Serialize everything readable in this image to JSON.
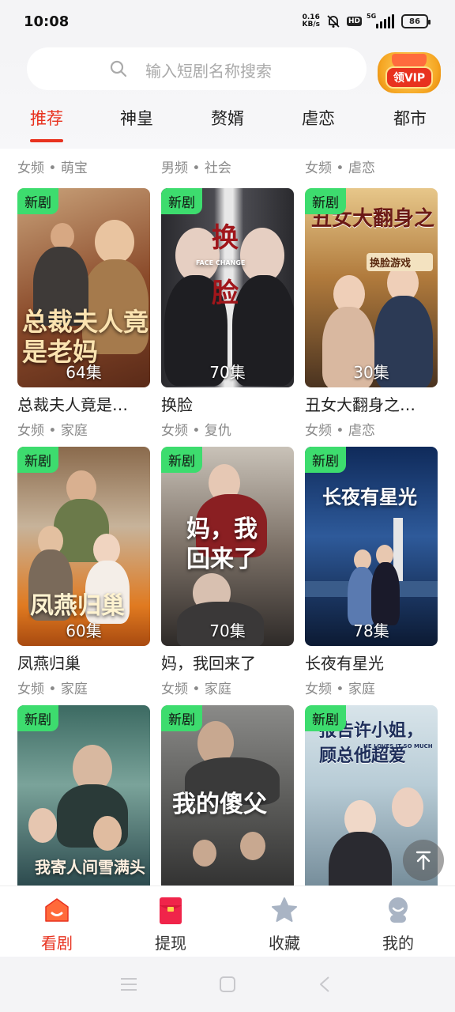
{
  "status": {
    "time": "10:08",
    "speed_top": "0.16",
    "speed_bottom": "KB/s",
    "hd": "HD",
    "network": "5G",
    "battery": "86"
  },
  "search": {
    "placeholder": "输入短剧名称搜索",
    "vip_label": "领VIP"
  },
  "tabs": [
    "推荐",
    "神皇",
    "赘婿",
    "虐恋",
    "都市"
  ],
  "partial_row": [
    {
      "meta": "女频 • 萌宝"
    },
    {
      "meta": "男频 • 社会"
    },
    {
      "meta": "女频 • 虐恋"
    }
  ],
  "cards": [
    {
      "badge": "新剧",
      "episodes": "64集",
      "title": "总裁夫人竟是…",
      "meta": "女频 • 家庭",
      "poster_text": "总裁夫人竟是老妈"
    },
    {
      "badge": "新剧",
      "episodes": "70集",
      "title": "换脸",
      "meta": "女频 • 复仇",
      "poster_text": "换脸",
      "poster_sub": "FACE CHANGE"
    },
    {
      "badge": "新剧",
      "episodes": "30集",
      "title": "丑女大翻身之…",
      "meta": "女频 • 虐恋",
      "poster_text": "丑女大翻身之",
      "poster_sub": "换脸游戏"
    },
    {
      "badge": "新剧",
      "episodes": "60集",
      "title": "凤燕归巢",
      "meta": "女频 • 家庭",
      "poster_text": "凤燕归巢"
    },
    {
      "badge": "新剧",
      "episodes": "70集",
      "title": "妈，我回来了",
      "meta": "女频 • 家庭",
      "poster_text": "妈，我回来了"
    },
    {
      "badge": "新剧",
      "episodes": "78集",
      "title": "长夜有星光",
      "meta": "女频 • 家庭",
      "poster_text": "长夜有星光"
    },
    {
      "badge": "新剧",
      "episodes": "",
      "title": "",
      "meta": "",
      "poster_text": "我寄人间雪满头"
    },
    {
      "badge": "新剧",
      "episodes": "",
      "title": "",
      "meta": "",
      "poster_text": "我的傻父"
    },
    {
      "badge": "新剧",
      "episodes": "",
      "title": "",
      "meta": "",
      "poster_text": "报告许小姐，顾总他超爱",
      "poster_sub": "HE LOVES IT SO MUCH"
    }
  ],
  "bottom_nav": [
    {
      "label": "看剧",
      "icon": "home-icon"
    },
    {
      "label": "提现",
      "icon": "red-envelope-icon"
    },
    {
      "label": "收藏",
      "icon": "star-icon"
    },
    {
      "label": "我的",
      "icon": "profile-icon"
    }
  ],
  "colors": {
    "accent": "#e8321f",
    "badge": "#3ddc6e",
    "meta": "#8a8a8a"
  }
}
